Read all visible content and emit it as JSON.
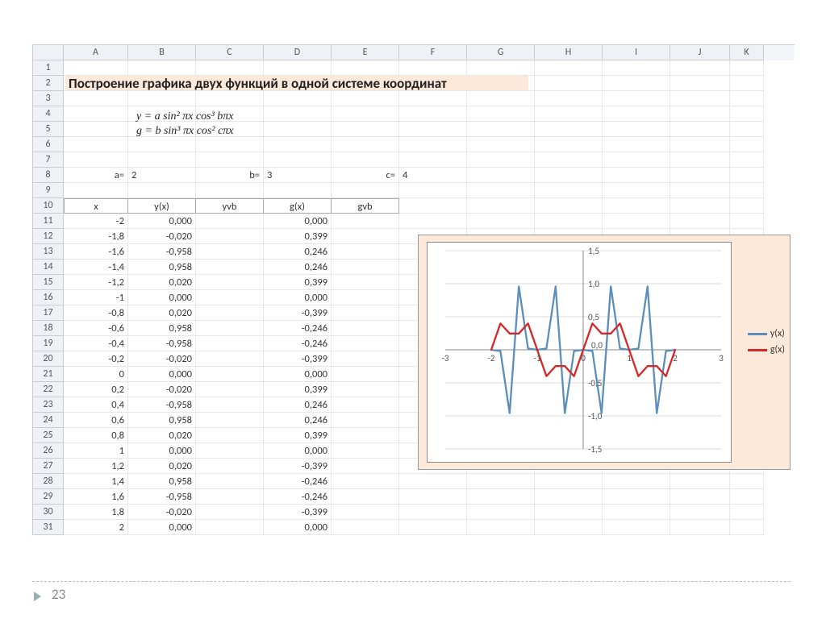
{
  "columns": [
    "A",
    "B",
    "C",
    "D",
    "E",
    "F",
    "G",
    "H",
    "I",
    "J",
    "K"
  ],
  "rowCount": 31,
  "title": "Построение графика двух функций в одной системе координат",
  "formula1": "y = a sin² πx cos³ bπx",
  "formula2": "g = b sin³ πx cos² cπx",
  "params": {
    "a_label": "a=",
    "a_value": "2",
    "b_label": "b=",
    "b_value": "3",
    "c_label": "c=",
    "c_value": "4"
  },
  "table": {
    "headers": [
      "x",
      "y(x)",
      "yvb",
      "g(x)",
      "gvb"
    ],
    "rows": [
      [
        "-2",
        "0,000",
        "",
        "0,000",
        ""
      ],
      [
        "-1,8",
        "-0,020",
        "",
        "0,399",
        ""
      ],
      [
        "-1,6",
        "-0,958",
        "",
        "0,246",
        ""
      ],
      [
        "-1,4",
        "0,958",
        "",
        "0,246",
        ""
      ],
      [
        "-1,2",
        "0,020",
        "",
        "0,399",
        ""
      ],
      [
        "-1",
        "0,000",
        "",
        "0,000",
        ""
      ],
      [
        "-0,8",
        "0,020",
        "",
        "-0,399",
        ""
      ],
      [
        "-0,6",
        "0,958",
        "",
        "-0,246",
        ""
      ],
      [
        "-0,4",
        "-0,958",
        "",
        "-0,246",
        ""
      ],
      [
        "-0,2",
        "-0,020",
        "",
        "-0,399",
        ""
      ],
      [
        "0",
        "0,000",
        "",
        "0,000",
        ""
      ],
      [
        "0,2",
        "-0,020",
        "",
        "0,399",
        ""
      ],
      [
        "0,4",
        "-0,958",
        "",
        "0,246",
        ""
      ],
      [
        "0,6",
        "0,958",
        "",
        "0,246",
        ""
      ],
      [
        "0,8",
        "0,020",
        "",
        "0,399",
        ""
      ],
      [
        "1",
        "0,000",
        "",
        "0,000",
        ""
      ],
      [
        "1,2",
        "0,020",
        "",
        "-0,399",
        ""
      ],
      [
        "1,4",
        "0,958",
        "",
        "-0,246",
        ""
      ],
      [
        "1,6",
        "-0,958",
        "",
        "-0,246",
        ""
      ],
      [
        "1,8",
        "-0,020",
        "",
        "-0,399",
        ""
      ],
      [
        "2",
        "0,000",
        "",
        "0,000",
        ""
      ]
    ]
  },
  "chart_data": {
    "type": "line",
    "title": "",
    "xlabel": "",
    "ylabel": "",
    "xlim": [
      -3,
      3
    ],
    "ylim": [
      -1.5,
      1.5
    ],
    "x_ticks": [
      -3,
      -2,
      -1,
      0,
      1,
      2,
      3
    ],
    "y_ticks": [
      -1.5,
      -1.0,
      -0.5,
      0.0,
      0.5,
      1.0,
      1.5
    ],
    "legend": [
      "y(x)",
      "g(x)"
    ],
    "colors": {
      "y(x)": "#5b8fb9",
      "g(x)": "#d62728"
    },
    "x": [
      -2,
      -1.8,
      -1.6,
      -1.4,
      -1.2,
      -1,
      -0.8,
      -0.6,
      -0.4,
      -0.2,
      0,
      0.2,
      0.4,
      0.6,
      0.8,
      1,
      1.2,
      1.4,
      1.6,
      1.8,
      2
    ],
    "series": [
      {
        "name": "y(x)",
        "values": [
          0,
          -0.02,
          -0.958,
          0.958,
          0.02,
          0,
          0.02,
          0.958,
          -0.958,
          -0.02,
          0,
          -0.02,
          -0.958,
          0.958,
          0.02,
          0,
          0.02,
          0.958,
          -0.958,
          -0.02,
          0
        ]
      },
      {
        "name": "g(x)",
        "values": [
          0,
          0.399,
          0.246,
          0.246,
          0.399,
          0,
          -0.399,
          -0.246,
          -0.246,
          -0.399,
          0,
          0.399,
          0.246,
          0.246,
          0.399,
          0,
          -0.399,
          -0.246,
          -0.246,
          -0.399,
          0
        ]
      }
    ]
  },
  "page_number": "23"
}
